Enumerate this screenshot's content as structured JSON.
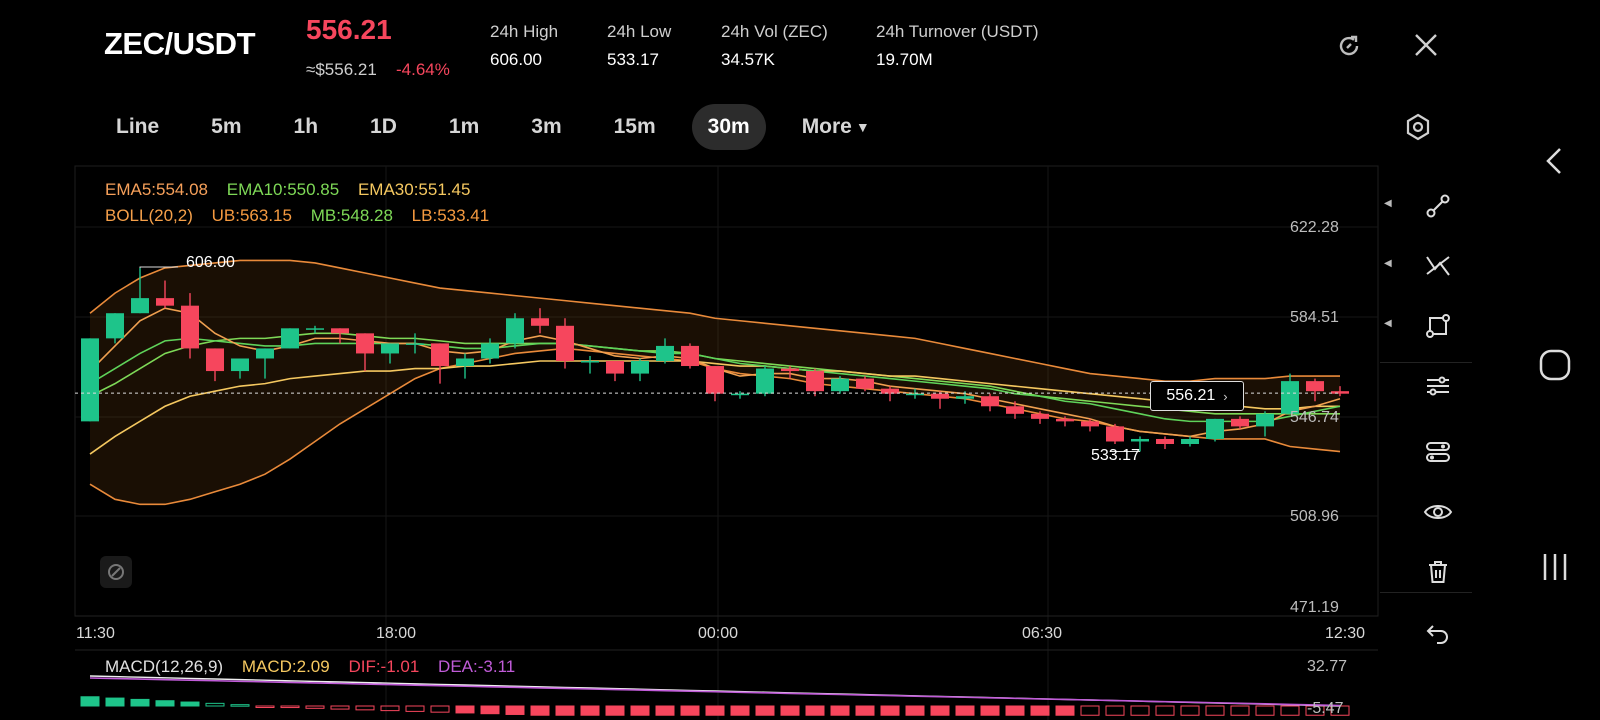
{
  "header": {
    "pair": "ZEC/USDT",
    "last_price": "556.21",
    "approx_price": "≈$556.21",
    "change_pct": "-4.64%",
    "stats": [
      {
        "label": "24h  High",
        "value": "606.00"
      },
      {
        "label": "24h  Low",
        "value": "533.17"
      },
      {
        "label": "24h  Vol (ZEC)",
        "value": "34.57K"
      },
      {
        "label": "24h  Turnover (USDT)",
        "value": "19.70M"
      }
    ]
  },
  "tabs": [
    {
      "label": "Line",
      "active": false
    },
    {
      "label": "5m",
      "active": false
    },
    {
      "label": "1h",
      "active": false
    },
    {
      "label": "1D",
      "active": false
    },
    {
      "label": "1m",
      "active": false
    },
    {
      "label": "3m",
      "active": false
    },
    {
      "label": "15m",
      "active": false
    },
    {
      "label": "30m",
      "active": true
    }
  ],
  "more_label": "More",
  "indicators": {
    "ema5": "EMA5:554.08",
    "ema10": "EMA10:550.85",
    "ema30": "EMA30:551.45",
    "boll": "BOLL(20,2)",
    "ub": "UB:563.15",
    "mb": "MB:548.28",
    "lb": "LB:533.41"
  },
  "macd": {
    "title": "MACD(12,26,9)",
    "macd": "MACD:2.09",
    "dif": "DIF:-1.01",
    "dea": "DEA:-3.11",
    "axis_top": "32.77",
    "axis_bottom": "-5.47"
  },
  "chart_data": {
    "type": "candlestick",
    "y_ticks": [
      "622.28",
      "584.51",
      "546.74",
      "508.96",
      "471.19"
    ],
    "ylim": [
      471.19,
      622.28
    ],
    "x_ticks": [
      "11:30",
      "18:00",
      "00:00",
      "06:30",
      "12:30"
    ],
    "current_price_tag": "556.21",
    "high_marker": "606.00",
    "low_marker": "533.17",
    "candles": [
      [
        545,
        578,
        545,
        578
      ],
      [
        578,
        588,
        576,
        588
      ],
      [
        588,
        606,
        588,
        594
      ],
      [
        594,
        601,
        590,
        591
      ],
      [
        591,
        596,
        570,
        574
      ],
      [
        574,
        574,
        561,
        565
      ],
      [
        565,
        570,
        562,
        570
      ],
      [
        570,
        574,
        562,
        574
      ],
      [
        574,
        582,
        574,
        582
      ],
      [
        582,
        583,
        580,
        582
      ],
      [
        582,
        582,
        576,
        580
      ],
      [
        580,
        580,
        565,
        572
      ],
      [
        572,
        576,
        568,
        576
      ],
      [
        576,
        580,
        572,
        576
      ],
      [
        576,
        576,
        560,
        567
      ],
      [
        567,
        572,
        562,
        570
      ],
      [
        570,
        578,
        568,
        576
      ],
      [
        576,
        588,
        574,
        586
      ],
      [
        586,
        590,
        580,
        583
      ],
      [
        583,
        586,
        566,
        569
      ],
      [
        569,
        571,
        564,
        569
      ],
      [
        569,
        569,
        561,
        564
      ],
      [
        564,
        570,
        561,
        569
      ],
      [
        569,
        578,
        568,
        575
      ],
      [
        575,
        576,
        566,
        567
      ],
      [
        567,
        567,
        553,
        556
      ],
      [
        556,
        557,
        554,
        556
      ],
      [
        556,
        567,
        555,
        566
      ],
      [
        566,
        567,
        562,
        565
      ],
      [
        565,
        566,
        555,
        557
      ],
      [
        557,
        563,
        556,
        562
      ],
      [
        562,
        563,
        557,
        558
      ],
      [
        558,
        559,
        553,
        556
      ],
      [
        556,
        558,
        554,
        556
      ],
      [
        556,
        557,
        550,
        554
      ],
      [
        554,
        557,
        552,
        555
      ],
      [
        555,
        556,
        549,
        551
      ],
      [
        551,
        553,
        546,
        548
      ],
      [
        548,
        549,
        544,
        546
      ],
      [
        546,
        547,
        543,
        545
      ],
      [
        545,
        546,
        541,
        543
      ],
      [
        543,
        544,
        536,
        537
      ],
      [
        537,
        539,
        533,
        538
      ],
      [
        538,
        539,
        534,
        536
      ],
      [
        536,
        539,
        535,
        538
      ],
      [
        538,
        546,
        537,
        546
      ],
      [
        546,
        547,
        542,
        543
      ],
      [
        543,
        549,
        539,
        548
      ],
      [
        548,
        564,
        548,
        561
      ],
      [
        561,
        562,
        553,
        557
      ],
      [
        557,
        559,
        555,
        556
      ]
    ],
    "ema5": [
      565,
      575,
      585,
      590,
      588,
      580,
      575,
      573,
      575,
      578,
      578,
      577,
      576,
      576,
      573,
      572,
      573,
      577,
      579,
      577,
      574,
      571,
      570,
      571,
      570,
      566,
      563,
      564,
      564,
      562,
      562,
      561,
      559,
      558,
      557,
      556,
      554,
      552,
      550,
      548,
      546,
      543,
      541,
      540,
      539,
      541,
      542,
      544,
      549,
      551,
      554
    ],
    "ema10": [
      560,
      566,
      572,
      577,
      578,
      577,
      576,
      575,
      575,
      576,
      576,
      576,
      576,
      576,
      575,
      574,
      574,
      575,
      576,
      576,
      575,
      574,
      573,
      572,
      572,
      570,
      568,
      567,
      566,
      565,
      564,
      563,
      562,
      561,
      560,
      559,
      558,
      556,
      555,
      553,
      552,
      550,
      548,
      546,
      545,
      545,
      545,
      545,
      547,
      549,
      551
    ],
    "ema30": [
      532,
      539,
      545,
      551,
      555,
      557,
      559,
      560,
      562,
      563,
      564,
      565,
      565,
      566,
      566,
      567,
      567,
      568,
      569,
      569,
      569,
      569,
      569,
      569,
      569,
      568,
      567,
      567,
      566,
      565,
      565,
      564,
      563,
      563,
      562,
      561,
      560,
      559,
      558,
      557,
      556,
      555,
      554,
      553,
      552,
      551,
      551,
      550,
      550,
      551,
      551
    ],
    "boll_ub": [
      588,
      596,
      602,
      606,
      607,
      608,
      609,
      609,
      609,
      608,
      606,
      604,
      602,
      600,
      598,
      597,
      596,
      595,
      594,
      593,
      592,
      591,
      590,
      589,
      588,
      586,
      585,
      584,
      583,
      582,
      581,
      580,
      579,
      578,
      576,
      574,
      572,
      570,
      568,
      566,
      564,
      563,
      562,
      561,
      561,
      562,
      562,
      562,
      563,
      563,
      563
    ],
    "boll_mb": [
      555,
      560,
      566,
      572,
      575,
      577,
      578,
      578,
      579,
      580,
      580,
      579,
      578,
      578,
      577,
      576,
      576,
      576,
      576,
      576,
      575,
      574,
      573,
      573,
      572,
      570,
      569,
      568,
      567,
      566,
      565,
      564,
      563,
      562,
      561,
      560,
      559,
      557,
      555,
      554,
      553,
      552,
      551,
      550,
      549,
      548,
      548,
      548,
      548,
      548,
      548
    ],
    "boll_lb": [
      520,
      514,
      512,
      512,
      514,
      517,
      520,
      524,
      530,
      537,
      544,
      550,
      556,
      562,
      566,
      568,
      570,
      572,
      573,
      574,
      573,
      572,
      571,
      570,
      569,
      566,
      564,
      563,
      562,
      560,
      559,
      558,
      557,
      556,
      555,
      554,
      552,
      550,
      548,
      546,
      545,
      543,
      541,
      540,
      539,
      538,
      538,
      538,
      535,
      534,
      533
    ]
  }
}
